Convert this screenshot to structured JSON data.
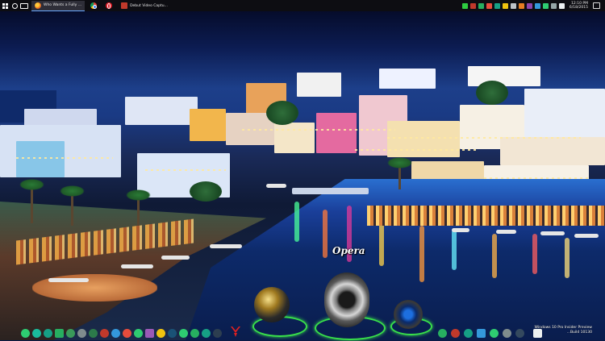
{
  "taskbar": {
    "apps": [
      {
        "icon": "firefox-icon",
        "label": "Who Wants a Fully ..."
      },
      {
        "icon": "chrome-icon",
        "label": ""
      },
      {
        "icon": "opera-icon",
        "label": ""
      },
      {
        "icon": "debut-icon",
        "label": "Debut Video Captu..."
      }
    ],
    "clock": {
      "time": "12:10 PM",
      "date": "6/18/2015"
    }
  },
  "dock": {
    "focused_label": "Opera",
    "focused_icon": "opera-icon",
    "accent_ring_color": "#39e04a"
  },
  "windows_version": {
    "line1": "Windows 10 Pro Insider Preview",
    "line2": "...Build 10130"
  }
}
